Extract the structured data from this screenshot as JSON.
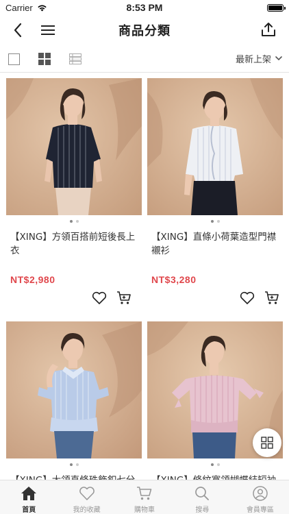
{
  "status_bar": {
    "carrier": "Carrier",
    "time": "8:53 PM"
  },
  "nav": {
    "title": "商品分類"
  },
  "toolbar": {
    "sort_label": "最新上架"
  },
  "products": [
    {
      "name": "【XING】方領百搭前短後長上衣",
      "price": "NT$2,980"
    },
    {
      "name": "【XING】直條小荷葉造型門襟襯衫",
      "price": "NT$3,280"
    },
    {
      "name": "【XING】大領直條珠飾釦七分",
      "price": ""
    },
    {
      "name": "【XING】條紋寬領蝴蝶結短袖",
      "price": ""
    }
  ],
  "tabs": [
    {
      "label": "首頁",
      "icon": "home-icon",
      "active": true
    },
    {
      "label": "我的收藏",
      "icon": "heart-icon",
      "active": false
    },
    {
      "label": "購物車",
      "icon": "cart-icon",
      "active": false
    },
    {
      "label": "搜尋",
      "icon": "search-icon",
      "active": false
    },
    {
      "label": "會員專區",
      "icon": "user-icon",
      "active": false
    }
  ],
  "colors": {
    "price": "#e0474c",
    "photo_bg": "#d4b295"
  }
}
